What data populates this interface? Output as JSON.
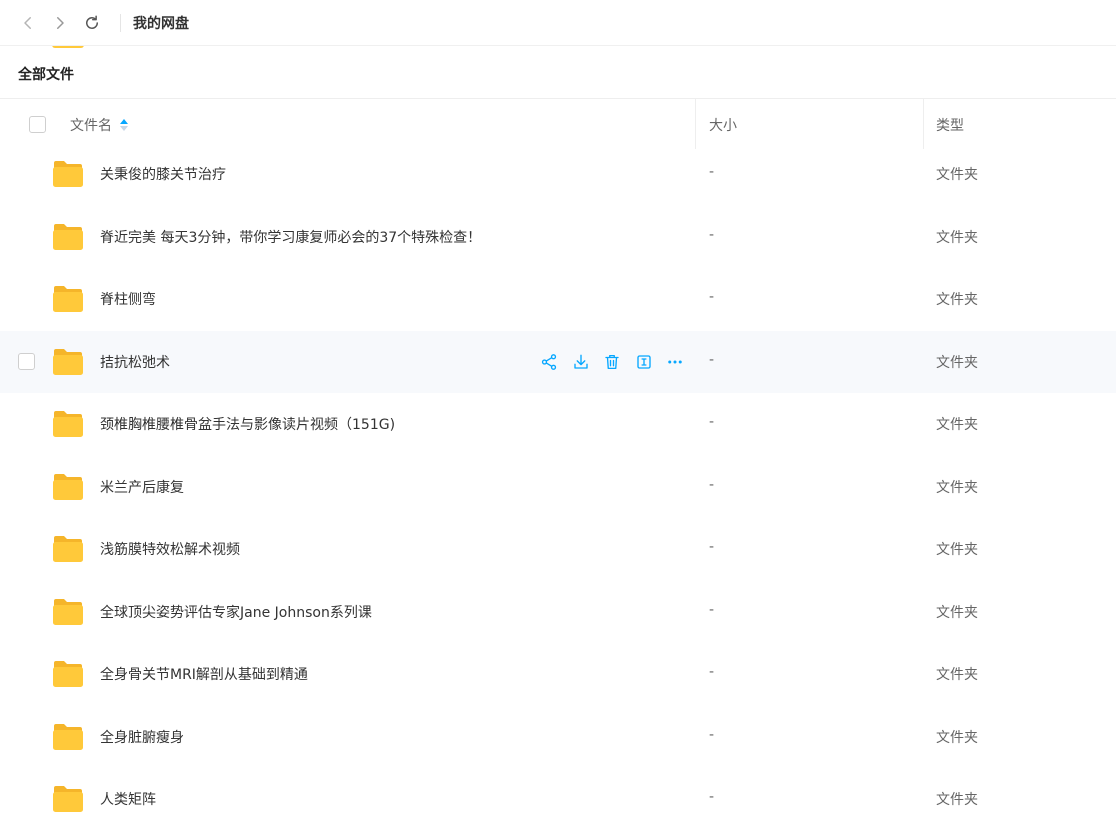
{
  "topbar": {
    "title": "我的网盘"
  },
  "section": {
    "title": "全部文件"
  },
  "table": {
    "columns": {
      "name": "文件名",
      "size": "大小",
      "type": "类型"
    },
    "rows": [
      {
        "name": "关秉俊的膝关节治疗",
        "size": "-",
        "type": "文件夹"
      },
      {
        "name": "脊近完美 每天3分钟，带你学习康复师必会的37个特殊检查！",
        "size": "-",
        "type": "文件夹"
      },
      {
        "name": "脊柱侧弯",
        "size": "-",
        "type": "文件夹"
      },
      {
        "name": "拮抗松弛术",
        "size": "-",
        "type": "文件夹"
      },
      {
        "name": "颈椎胸椎腰椎骨盆手法与影像读片视频（151G)",
        "size": "-",
        "type": "文件夹"
      },
      {
        "name": "米兰产后康复",
        "size": "-",
        "type": "文件夹"
      },
      {
        "name": "浅筋膜特效松解术视频",
        "size": "-",
        "type": "文件夹"
      },
      {
        "name": "全球顶尖姿势评估专家Jane Johnson系列课",
        "size": "-",
        "type": "文件夹"
      },
      {
        "name": "全身骨关节MRI解剖从基础到精通",
        "size": "-",
        "type": "文件夹"
      },
      {
        "name": "全身脏腑瘦身",
        "size": "-",
        "type": "文件夹"
      },
      {
        "name": "人类矩阵",
        "size": "-",
        "type": "文件夹"
      }
    ],
    "hovered_row_index": 3
  },
  "icons": {
    "back": "chevron-left-icon",
    "forward": "chevron-right-icon",
    "refresh": "refresh-icon",
    "folder": "folder-icon",
    "share": "share-icon",
    "download": "download-icon",
    "delete": "trash-icon",
    "rename": "rename-icon",
    "more": "more-icon"
  },
  "colors": {
    "accent": "#06a7ff",
    "folder": "#ffc93a",
    "hover_row": "#f7f9fc"
  }
}
